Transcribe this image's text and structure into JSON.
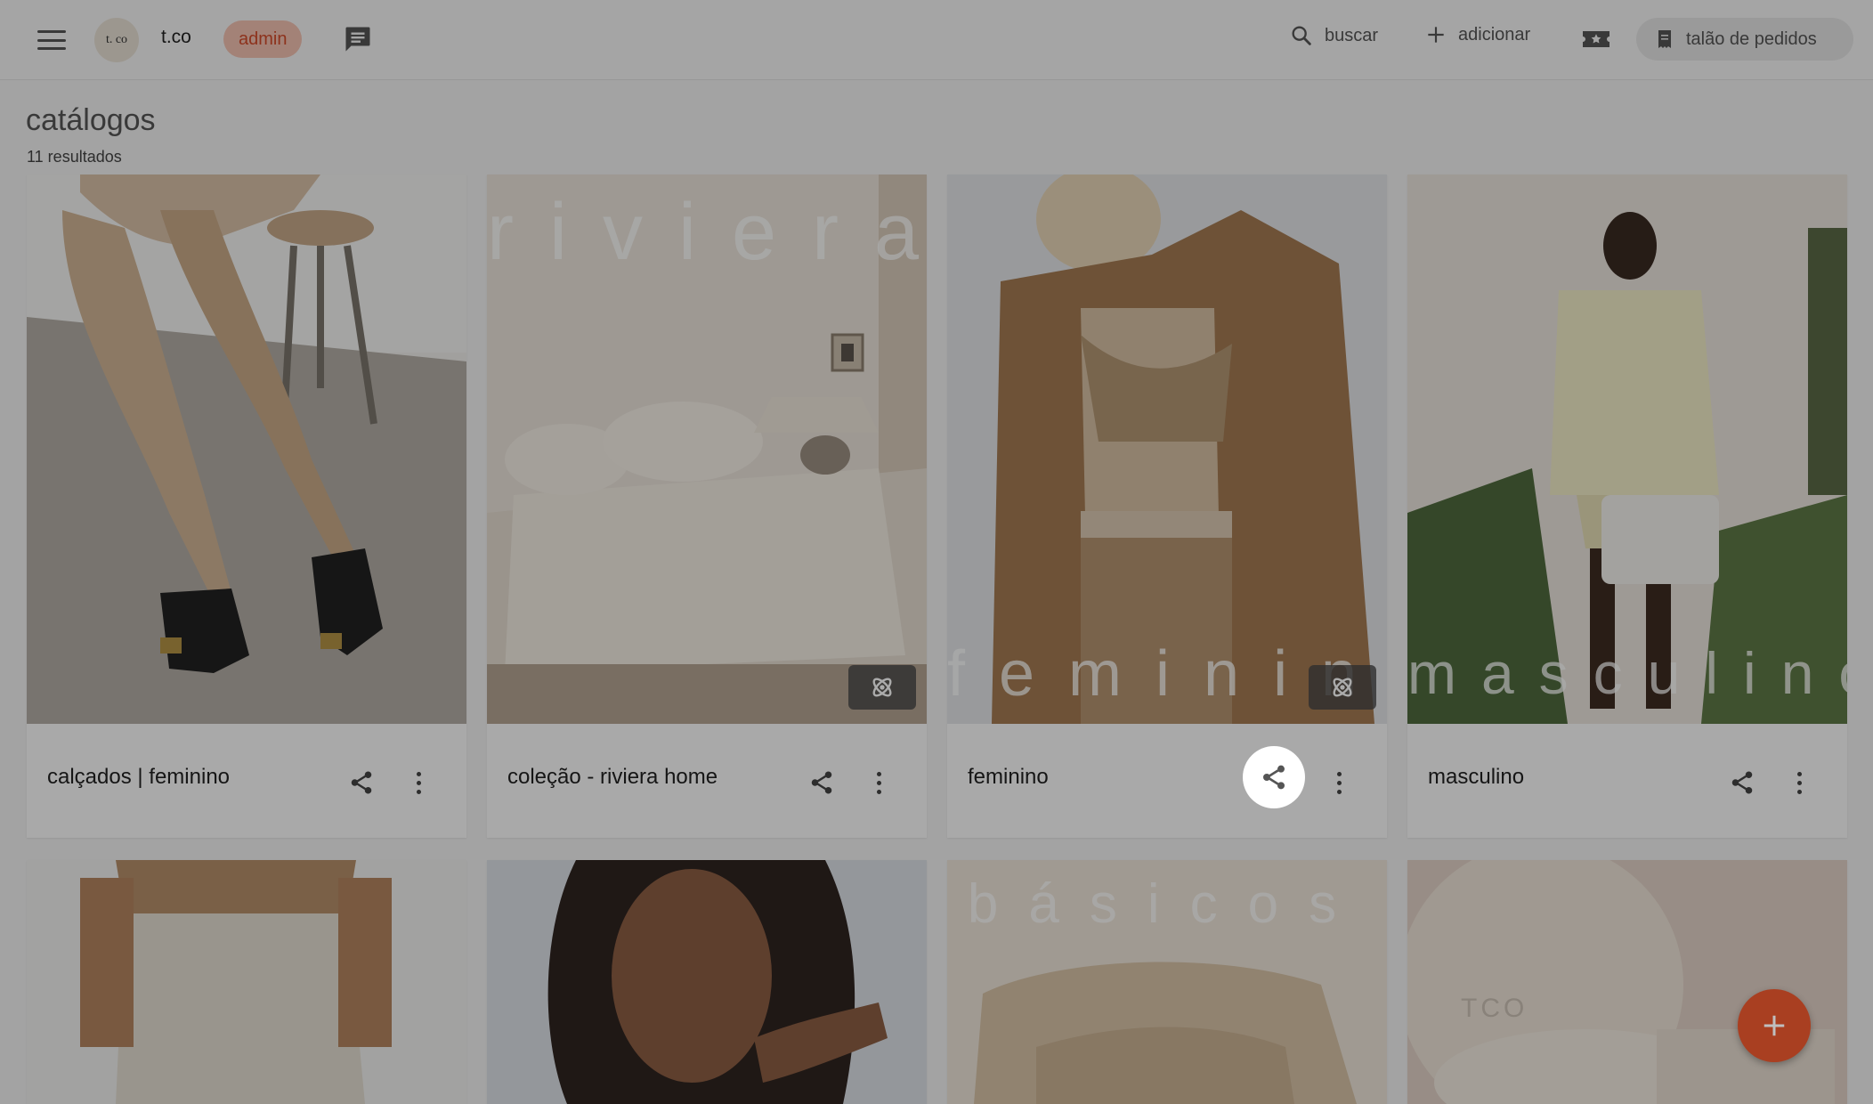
{
  "header": {
    "menu_icon": "hamburger-menu-icon",
    "logo_text": "t. co",
    "brand": "t.co",
    "role_badge": "admin",
    "chat_icon": "chat-icon",
    "search_label": "buscar",
    "add_label": "adicionar",
    "ticket_icon": "star-ticket-icon",
    "orders_label": "talão de pedidos"
  },
  "page": {
    "title": "catálogos",
    "results": "11 resultados"
  },
  "cards": [
    {
      "name": "calçados | feminino",
      "overlay": "",
      "ar": false
    },
    {
      "name": "coleção - riviera home",
      "overlay": "riviera",
      "ar": true
    },
    {
      "name": "feminino",
      "overlay": "feminino",
      "ar": true
    },
    {
      "name": "masculino",
      "overlay": "masculino",
      "ar": false
    },
    {
      "name": "",
      "overlay": "",
      "ar": false
    },
    {
      "name": "",
      "overlay": "",
      "ar": false
    },
    {
      "name": "",
      "overlay": "básicos",
      "ar": false
    },
    {
      "name": "",
      "overlay": "TCO",
      "ar": false
    }
  ],
  "colors": {
    "accent": "#e2542c",
    "badge_bg": "#f3c2b2",
    "badge_text": "#d24b2a"
  }
}
